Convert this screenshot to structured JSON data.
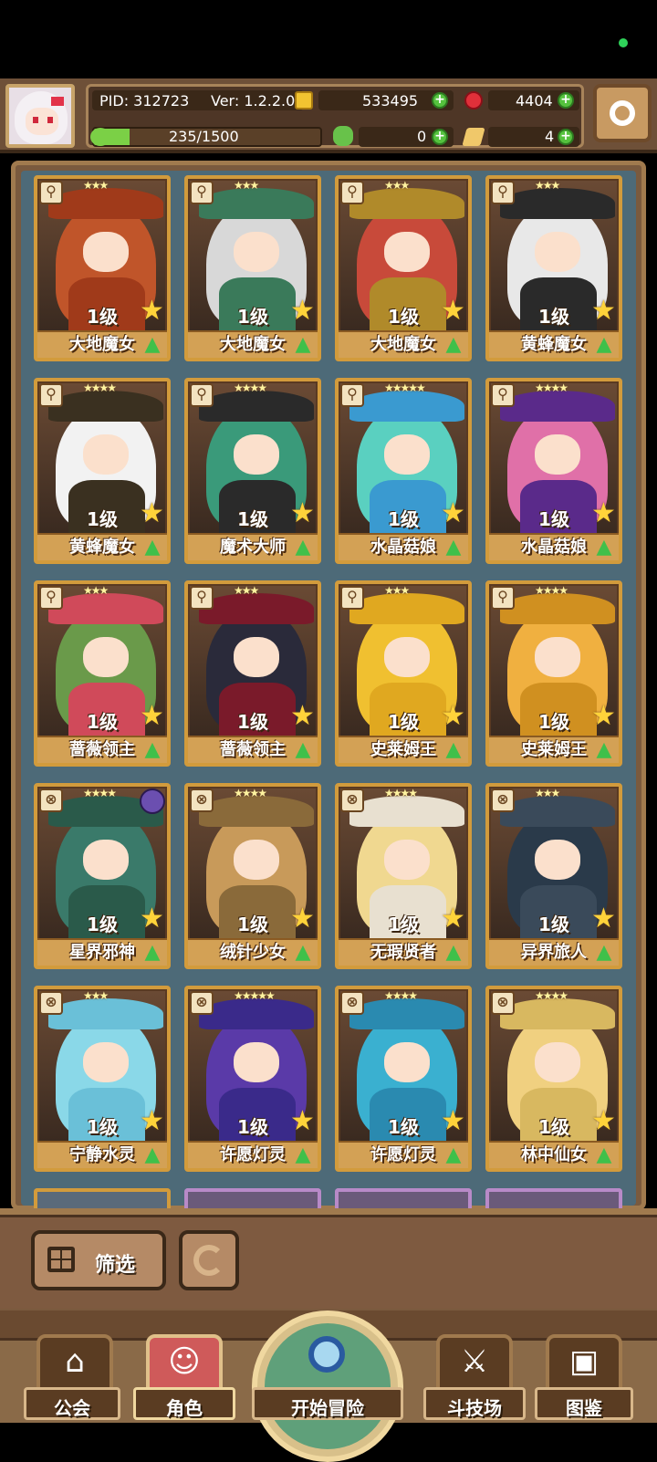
{
  "player": {
    "pid": "PID: 312723",
    "version": "Ver: 1.2.2.0",
    "xp": "235/1500",
    "xp_progress": 0.157
  },
  "resources": {
    "coins": "533495",
    "gems": "4404",
    "clovers": "0",
    "feathers": "4"
  },
  "colors": {
    "accent": "#d29b3c",
    "frame": "#7a5a3e",
    "positive": "#55c23e"
  },
  "cards": [
    {
      "level": "1级",
      "name": "大地魔女",
      "stars": "★★★",
      "hair": "#c0552a",
      "hat": "#a03a1a"
    },
    {
      "level": "1级",
      "name": "大地魔女",
      "stars": "★★★",
      "hair": "#d8d8d8",
      "hat": "#3a7a5a"
    },
    {
      "level": "1级",
      "name": "大地魔女",
      "stars": "★★★",
      "hair": "#c84a3a",
      "hat": "#b08a2a"
    },
    {
      "level": "1级",
      "name": "黄蜂魔女",
      "stars": "★★★",
      "hair": "#e8e8e8",
      "hat": "#2a2a2a"
    },
    {
      "level": "1级",
      "name": "黄蜂魔女",
      "stars": "★★★★",
      "hair": "#f2f2f2",
      "hat": "#3a3020"
    },
    {
      "level": "1级",
      "name": "魔术大师",
      "stars": "★★★★",
      "hair": "#3a9a7a",
      "hat": "#2a2a2a"
    },
    {
      "level": "1级",
      "name": "水晶菇娘",
      "stars": "★★★★★",
      "hair": "#5ad0c0",
      "hat": "#3a9ad0"
    },
    {
      "level": "1级",
      "name": "水晶菇娘",
      "stars": "★★★★",
      "hair": "#e070a8",
      "hat": "#5a2a8a"
    },
    {
      "level": "1级",
      "name": "蔷薇领主",
      "stars": "★★★",
      "hair": "#6a9a4a",
      "hat": "#d04a5a"
    },
    {
      "level": "1级",
      "name": "蔷薇领主",
      "stars": "★★★",
      "hair": "#2a2a3a",
      "hat": "#7a1a2a"
    },
    {
      "level": "1级",
      "name": "史莱姆王",
      "stars": "★★★",
      "hair": "#f0c030",
      "hat": "#e0a820"
    },
    {
      "level": "1级",
      "name": "史莱姆王",
      "stars": "★★★★",
      "hair": "#f0b040",
      "hat": "#d09020"
    },
    {
      "level": "1级",
      "name": "星界邪神",
      "stars": "★★★★",
      "hair": "#3a7a6a",
      "hat": "#2a5a4a"
    },
    {
      "level": "1级",
      "name": "绒针少女",
      "stars": "★★★★",
      "hair": "#c89a5a",
      "hat": "#8a6a3a"
    },
    {
      "level": "1级",
      "name": "无瑕贤者",
      "stars": "★★★★",
      "hair": "#f0d890",
      "hat": "#e8e0d0"
    },
    {
      "level": "1级",
      "name": "异界旅人",
      "stars": "★★★",
      "hair": "#2a3a4a",
      "hat": "#3a4a5a"
    },
    {
      "level": "1级",
      "name": "宁静水灵",
      "stars": "★★★",
      "hair": "#8ad8e8",
      "hat": "#6ac0d8"
    },
    {
      "level": "1级",
      "name": "许愿灯灵",
      "stars": "★★★★★",
      "hair": "#5a3aa8",
      "hat": "#3a2a8a"
    },
    {
      "level": "1级",
      "name": "许愿灯灵",
      "stars": "★★★★",
      "hair": "#3ab0d0",
      "hat": "#2a8ab0"
    },
    {
      "level": "1级",
      "name": "林中仙女",
      "stars": "★★★★",
      "hair": "#f0d080",
      "hat": "#d8b860"
    }
  ],
  "toolbar": {
    "filter_label": "筛选"
  },
  "nav": {
    "guild": "公会",
    "character": "角色",
    "adventure": "开始冒险",
    "arena": "斗技场",
    "codex": "图鉴"
  }
}
